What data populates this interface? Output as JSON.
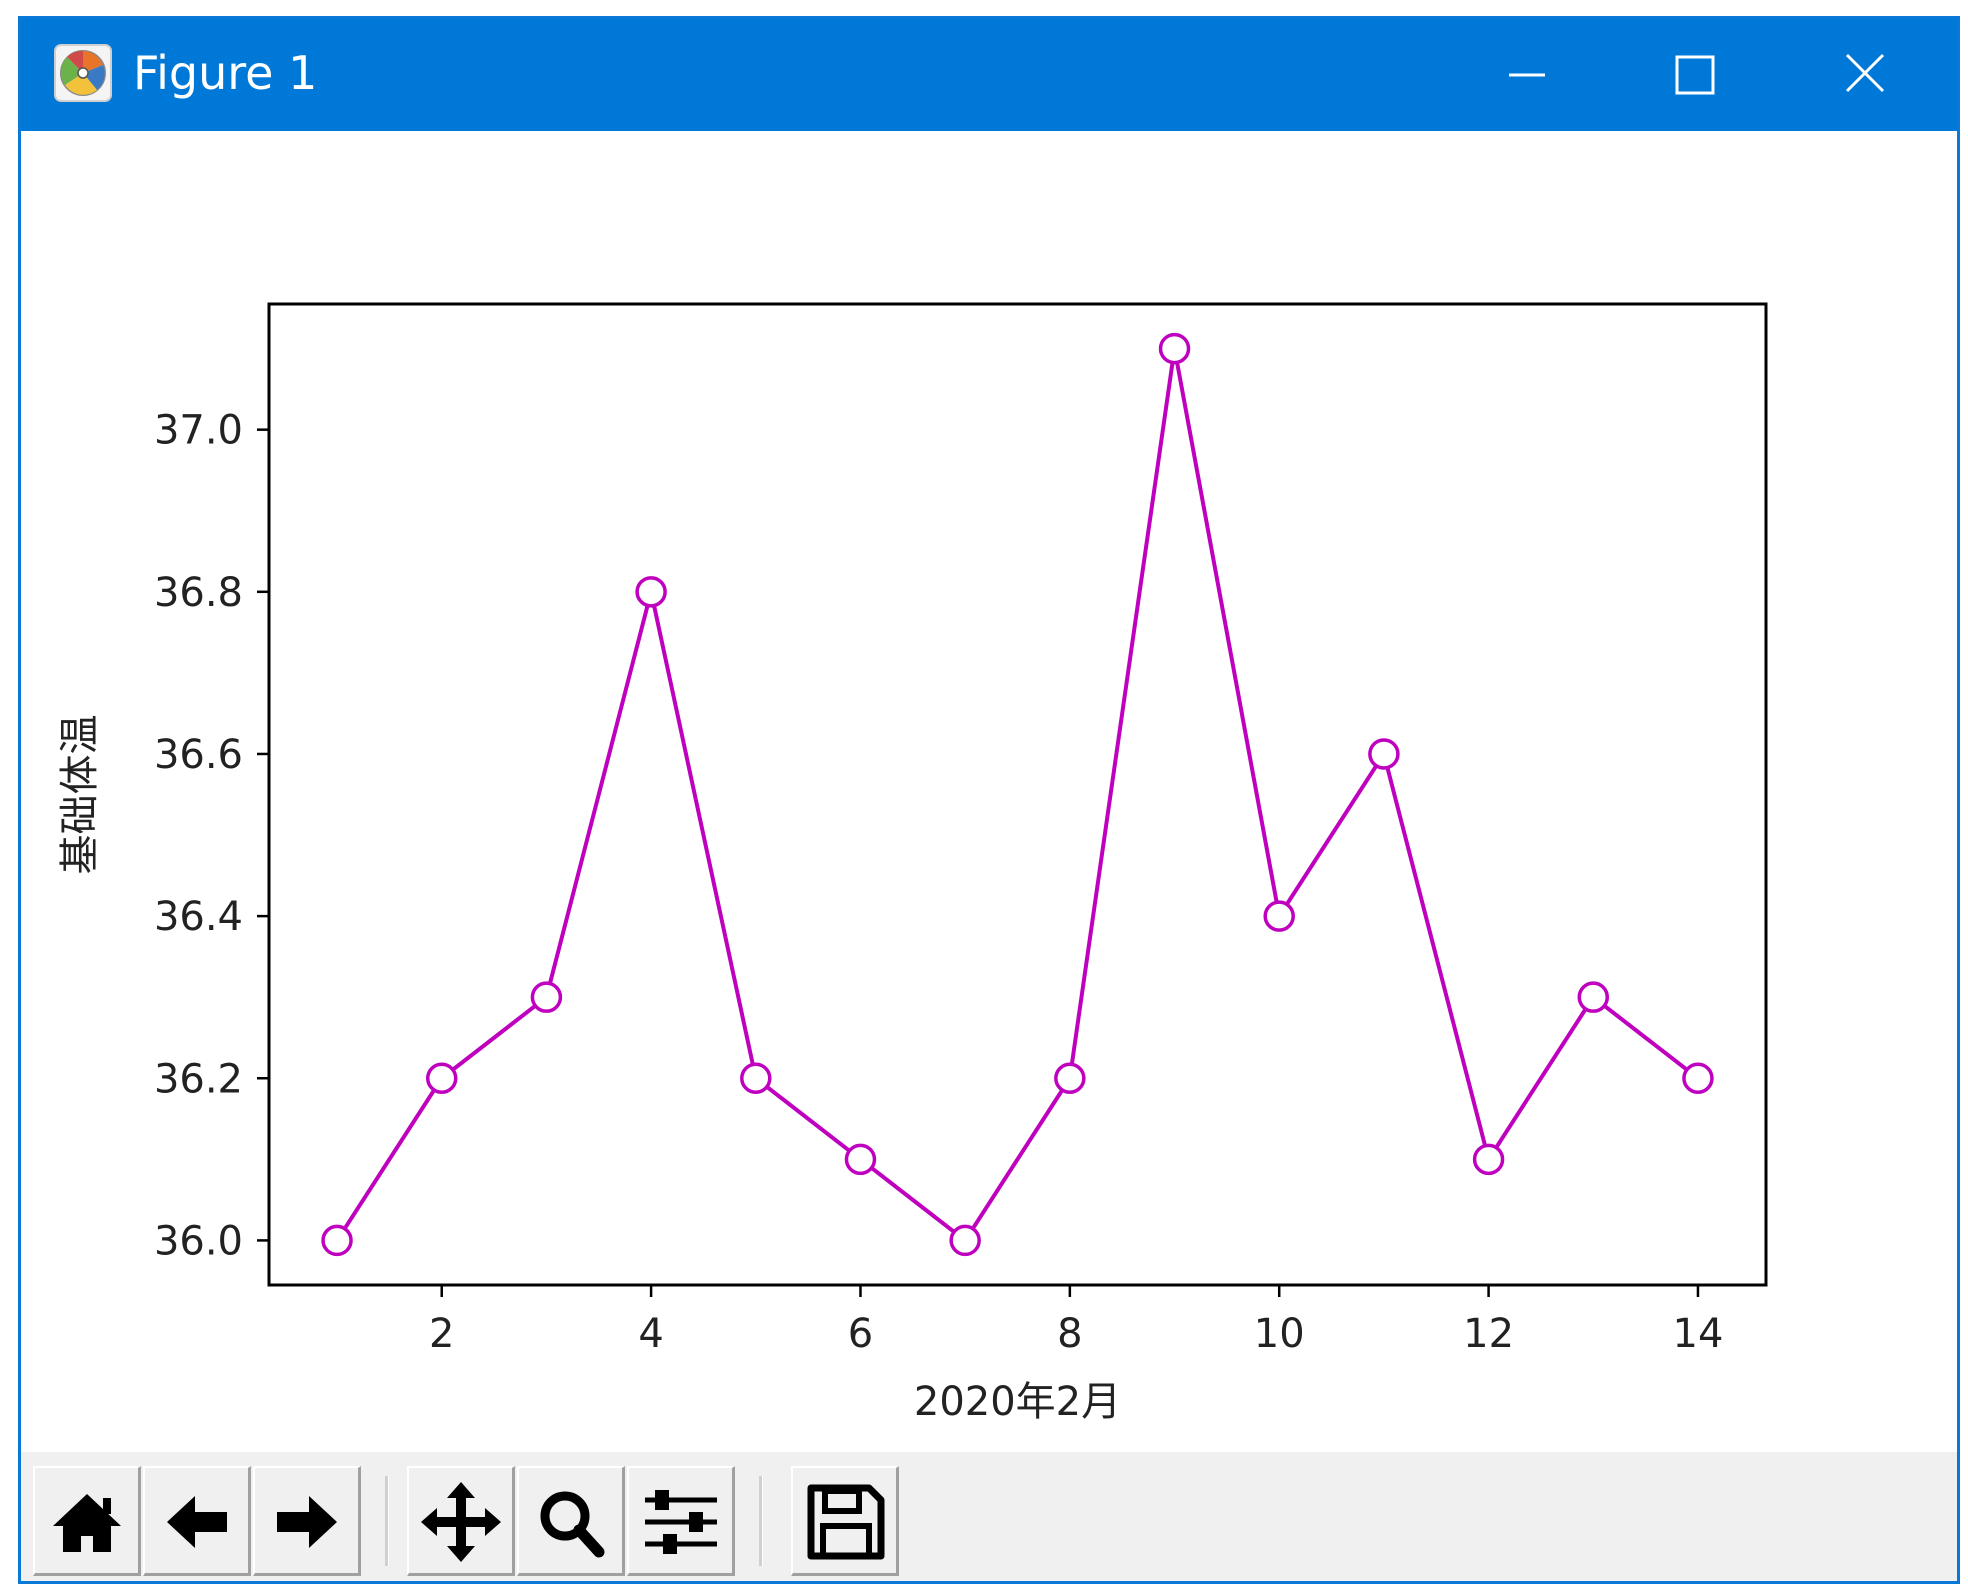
{
  "window": {
    "title": "Figure 1",
    "title_bar_color": "#0078d7",
    "icons": {
      "app": "matplotlib-icon",
      "minimize": "minimize-icon",
      "maximize": "maximize-icon",
      "close": "close-icon"
    }
  },
  "chart_data": {
    "type": "line",
    "x": [
      1,
      2,
      3,
      4,
      5,
      6,
      7,
      8,
      9,
      10,
      11,
      12,
      13,
      14
    ],
    "series": [
      {
        "values": [
          36.0,
          36.2,
          36.3,
          36.8,
          36.2,
          36.1,
          36.0,
          36.2,
          37.1,
          36.4,
          36.6,
          36.1,
          36.3,
          36.2
        ],
        "color": "#bf00bf",
        "marker": "circle-hollow"
      }
    ],
    "title": "",
    "xlabel": "2020年2月",
    "ylabel": "基础体温",
    "xticks": [
      2,
      4,
      6,
      8,
      10,
      12,
      14
    ],
    "xtick_labels": [
      "2",
      "4",
      "6",
      "8",
      "10",
      "12",
      "14"
    ],
    "yticks": [
      36.0,
      36.2,
      36.4,
      36.6,
      36.8,
      37.0
    ],
    "ytick_labels": [
      "36.0",
      "36.2",
      "36.4",
      "36.6",
      "36.8",
      "37.0"
    ],
    "xlim": [
      0.35,
      14.65
    ],
    "ylim": [
      35.945,
      37.155
    ],
    "grid": false,
    "legend": "none"
  },
  "toolbar": {
    "buttons": [
      {
        "name": "home-button",
        "icon": "home-icon"
      },
      {
        "name": "back-button",
        "icon": "arrow-left-icon"
      },
      {
        "name": "forward-button",
        "icon": "arrow-right-icon"
      },
      {
        "name": "pan-button",
        "icon": "move-icon"
      },
      {
        "name": "zoom-button",
        "icon": "magnifier-icon"
      },
      {
        "name": "subplots-button",
        "icon": "sliders-icon"
      },
      {
        "name": "save-button",
        "icon": "floppy-disk-icon"
      }
    ]
  }
}
